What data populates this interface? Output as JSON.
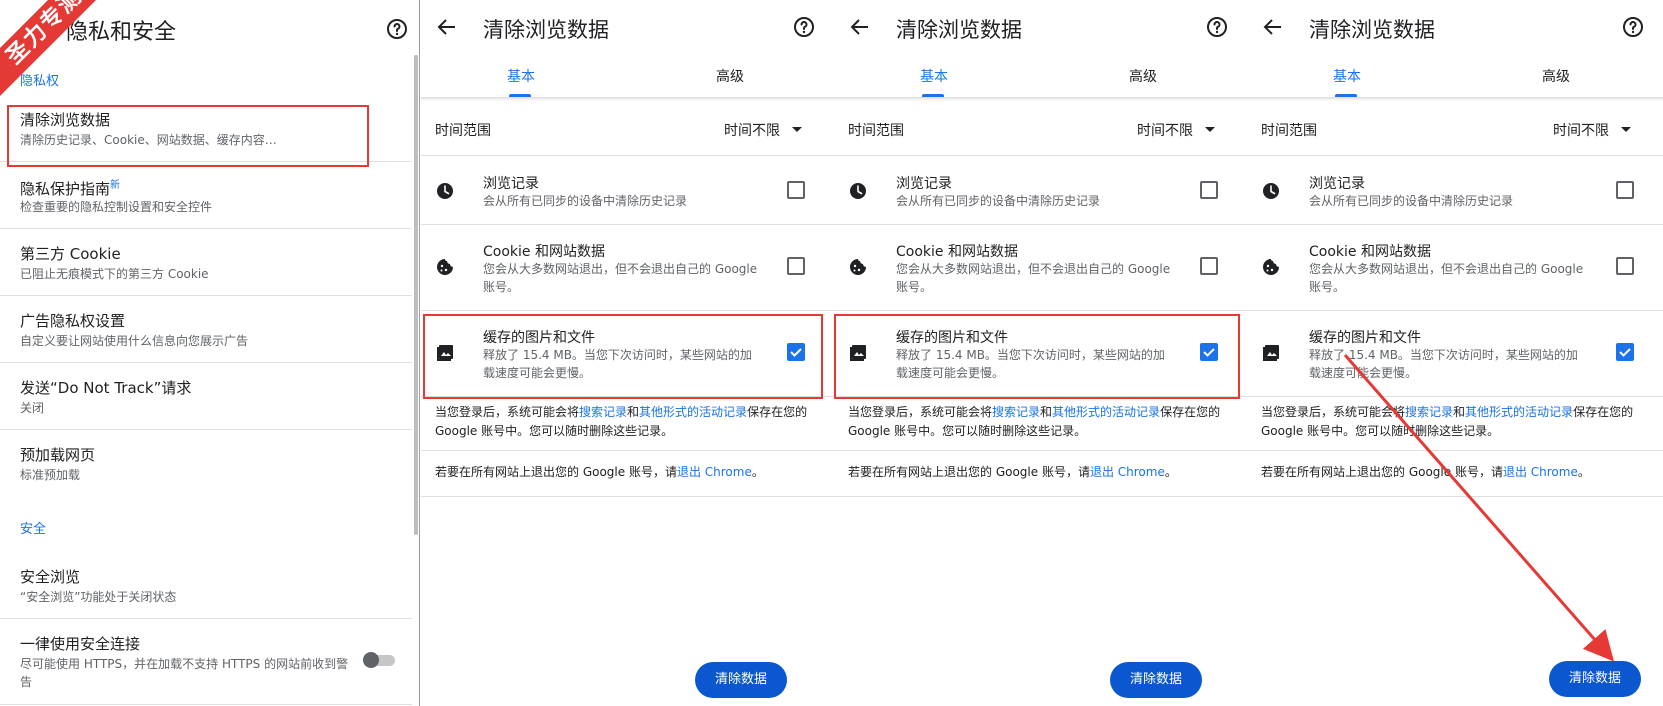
{
  "ribbon": "圣力专测",
  "privacy": {
    "title": "隐私和安全",
    "section_privacy": "隐私权",
    "section_security": "安全",
    "items": [
      {
        "title": "清除浏览数据",
        "sub": "清除历史记录、Cookie、网站数据、缓存内容…"
      },
      {
        "title": "隐私保护指南",
        "badge": "新",
        "sub": "检查重要的隐私控制设置和安全控件"
      },
      {
        "title": "第三方 Cookie",
        "sub": "已阻止无痕模式下的第三方 Cookie"
      },
      {
        "title": "广告隐私权设置",
        "sub": "自定义要让网站使用什么信息向您展示广告"
      },
      {
        "title": "发送“Do Not Track”请求",
        "sub": "关闭"
      },
      {
        "title": "预加载网页",
        "sub": "标准预加载"
      },
      {
        "title": "安全浏览",
        "sub": "“安全浏览”功能处于关闭状态"
      },
      {
        "title": "一律使用安全连接",
        "sub": "尽可能使用 HTTPS，并在加载不支持 HTTPS 的网站前收到警告"
      }
    ]
  },
  "clear": {
    "title": "清除浏览数据",
    "tab_basic": "基本",
    "tab_advanced": "高级",
    "range_label": "时间范围",
    "range_value": "时间不限",
    "history_title": "浏览记录",
    "history_sub": "会从所有已同步的设备中清除历史记录",
    "cookie_title": "Cookie 和网站数据",
    "cookie_sub": "您会从大多数网站退出，但不会退出自己的 Google 账号。",
    "cache_title": "缓存的图片和文件",
    "cache_sub": "释放了 15.4 MB。当您下次访问时，某些网站的加载速度可能会更慢。",
    "info1_pre": "当您登录后，系统可能会将",
    "info1_link1": "搜索记录",
    "info1_mid": "和",
    "info1_link2": "其他形式的活动记录",
    "info1_post": "保存在您的 Google 账号中。您可以随时删除这些记录。",
    "info2_pre": "若要在所有网站上退出您的 Google 账号，请",
    "info2_link": "退出 Chrome",
    "info2_post": "。",
    "button": "清除数据"
  },
  "colors": {
    "accent": "#1a73e8",
    "button": "#0b57d0",
    "highlight": "#e53935"
  }
}
